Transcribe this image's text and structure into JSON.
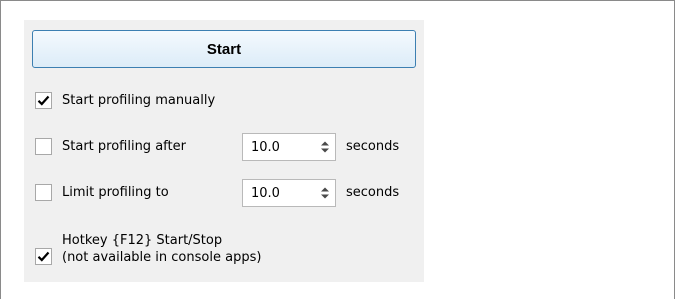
{
  "profiler": {
    "start_button_label": "Start",
    "start_manually": {
      "label": "Start profiling manually",
      "checked": true
    },
    "start_after": {
      "label": "Start profiling after",
      "checked": false,
      "value": "10.0",
      "unit": "seconds"
    },
    "limit_to": {
      "label": "Limit profiling to",
      "checked": false,
      "value": "10.0",
      "unit": "seconds"
    },
    "hotkey": {
      "line1": "Hotkey {F12} Start/Stop",
      "line2": "(not available in console apps)",
      "checked": true
    }
  },
  "icons": {
    "check": "checkmark-icon",
    "spinner": "spinner-arrows-icon"
  }
}
